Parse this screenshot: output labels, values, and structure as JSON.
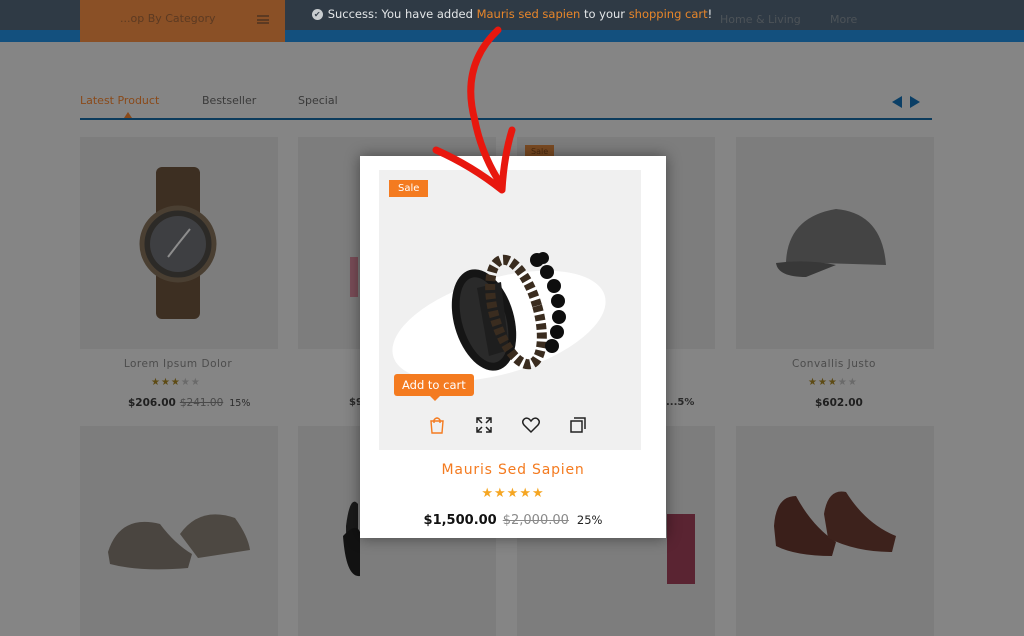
{
  "notification": {
    "prefix": "Success: You have added ",
    "product": "Mauris sed sapien",
    "middle": " to your ",
    "link": "shopping cart",
    "suffix": "!"
  },
  "header": {
    "category_label": "...op By Category",
    "nav": [
      "Home & Living",
      "More"
    ]
  },
  "tabs": [
    "Latest Product",
    "Bestseller",
    "Special"
  ],
  "products_background": [
    {
      "name": "Lorem Ipsum Dolor",
      "rating": 3,
      "price": "$206.00",
      "old_price": "$241.00",
      "discount": "15%"
    },
    {
      "name": "Convallis Justo",
      "rating": 3,
      "price": "$602.00"
    }
  ],
  "partial_prices": [
    "$9...",
    "...5%"
  ],
  "background_sale_label": "Sale",
  "featured": {
    "sale_label": "Sale",
    "tooltip": "Add to cart",
    "name": "Mauris Sed Sapien",
    "rating": 5,
    "stars_text": "★★★★★",
    "price": "$1,500.00",
    "old_price": "$2,000.00",
    "discount": "25%"
  },
  "icons": [
    "shopping-bag-icon",
    "expand-icon",
    "heart-icon",
    "compare-icon",
    "check-circle-icon",
    "arrow-prev-icon",
    "arrow-next-icon",
    "menu-icon"
  ],
  "colors": {
    "accent": "#f47b20",
    "star": "#f5a623",
    "arrow": "#e8170e",
    "nav_blue": "#0b3f66"
  }
}
